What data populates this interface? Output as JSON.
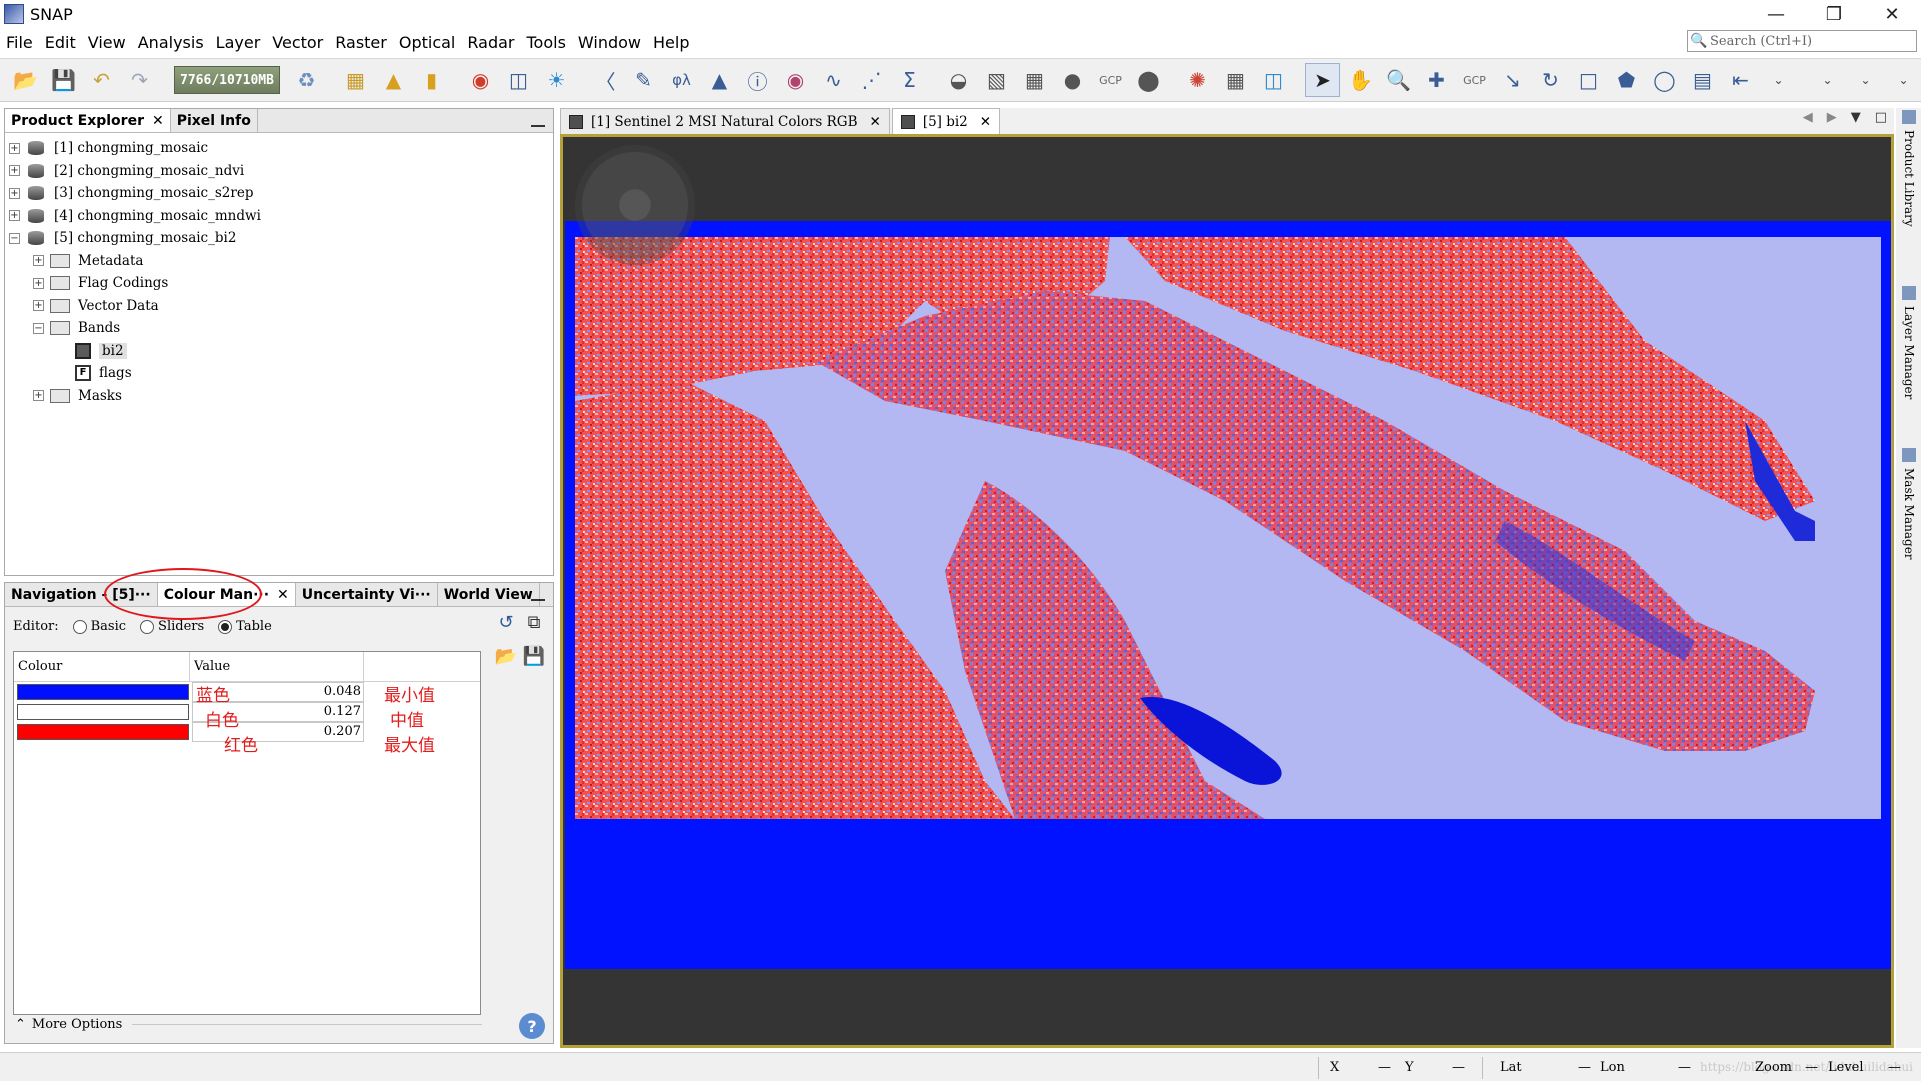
{
  "app": {
    "title": "SNAP"
  },
  "window_controls": {
    "minimize": "—",
    "restore": "❐",
    "close": "✕"
  },
  "menu": [
    "File",
    "Edit",
    "View",
    "Analysis",
    "Layer",
    "Vector",
    "Raster",
    "Optical",
    "Radar",
    "Tools",
    "Window",
    "Help"
  ],
  "search": {
    "placeholder": "Search (Ctrl+I)"
  },
  "toolbar": {
    "memory": "7766/10710MB",
    "gcp_label": "GCP"
  },
  "product_explorer": {
    "tabs": [
      "Product Explorer",
      "Pixel Info"
    ],
    "products": [
      {
        "label": "[1] chongming_mosaic"
      },
      {
        "label": "[2] chongming_mosaic_ndvi"
      },
      {
        "label": "[3] chongming_mosaic_s2rep"
      },
      {
        "label": "[4] chongming_mosaic_mndwi"
      },
      {
        "label": "[5] chongming_mosaic_bi2"
      }
    ],
    "children": [
      "Metadata",
      "Flag Codings",
      "Vector Data",
      "Bands",
      "Masks"
    ],
    "bands": [
      "bi2",
      "flags"
    ]
  },
  "lower_panel": {
    "tabs": [
      "Navigation - [5]···",
      "Colour Man···",
      "Uncertainty Vi···",
      "World View"
    ],
    "editor_label": "Editor:",
    "editor_options": [
      "Basic",
      "Sliders",
      "Table"
    ],
    "editor_selected": "Table",
    "table_headers": [
      "Colour",
      "Value"
    ],
    "table_rows": [
      {
        "color": "#0010ff",
        "value": "0.048"
      },
      {
        "color": "#ffffff",
        "value": "0.127"
      },
      {
        "color": "#ff0000",
        "value": "0.207"
      }
    ],
    "more_options": "More Options"
  },
  "annotations": {
    "blue": "蓝色",
    "white": "白色",
    "red": "红色",
    "min": "最小值",
    "mid": "中值",
    "max": "最大值"
  },
  "document_tabs": [
    {
      "label": "[1] Sentinel 2 MSI Natural Colors RGB"
    },
    {
      "label": "[5] bi2"
    }
  ],
  "side_tabs": [
    "Product Library",
    "Layer Manager",
    "Mask Manager"
  ],
  "status_bar": {
    "x_label": "X",
    "x_val": "—",
    "y_label": "Y",
    "y_val": "—",
    "lat_label": "Lat",
    "lat_val": "—",
    "lon_label": "Lon",
    "lon_val": "—",
    "zoom_label": "Zoom",
    "zoom_val": "—",
    "level_label": "Level",
    "level_val": "—",
    "watermark": "https://blog.csdn.net/lidahuilidahui"
  }
}
